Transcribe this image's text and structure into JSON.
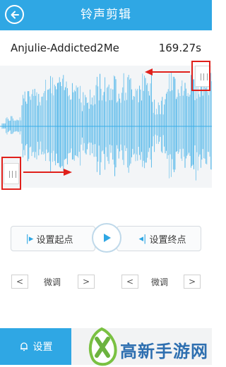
{
  "header": {
    "title": "铃声剪辑"
  },
  "song": {
    "name": "Anjulie-Addicted2Me",
    "duration": "169.27s"
  },
  "controls": {
    "set_start": "设置起点",
    "set_end": "设置终点"
  },
  "fine_tune": {
    "left_label": "微调",
    "right_label": "微调",
    "prev": "<",
    "next": ">"
  },
  "bottom": {
    "settings_label": "设置",
    "brand_text": "高新手游网"
  },
  "colors": {
    "accent": "#2fa7e4",
    "wave": "#3aaee8",
    "highlight": "#e0201b"
  }
}
